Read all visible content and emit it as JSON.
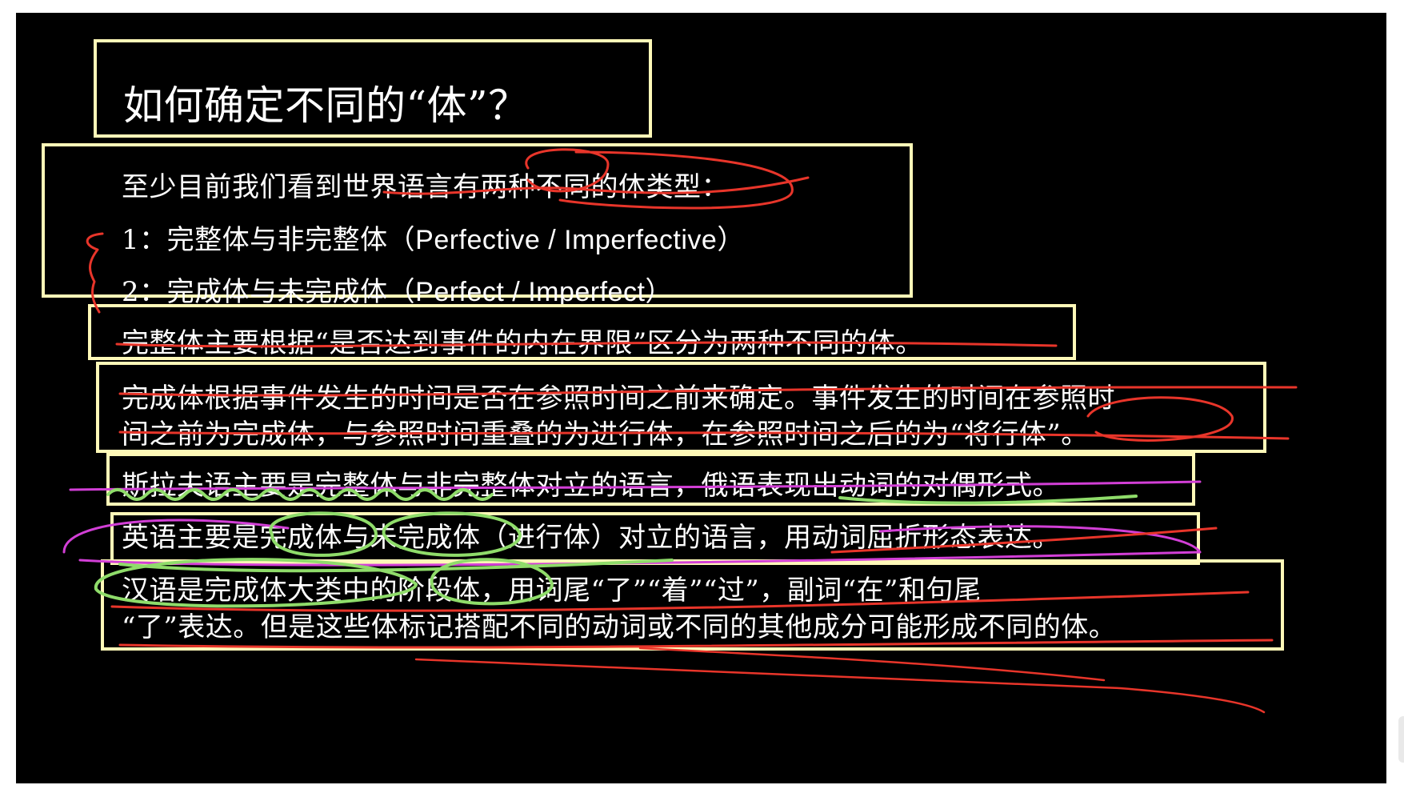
{
  "slide": {
    "title": "如何确定不同的“体”？",
    "intro": {
      "line1": "至少目前我们看到世界语言有两种不同的体类型：",
      "line2_num": "1：完整体与非完整体（",
      "line2_en": "Perfective / Imperfective",
      "line2_end": "）",
      "line3_num": "2：完成体与未完成体（",
      "line3_en": "Perfect / Imperfect",
      "line3_end": "）"
    },
    "perfective_def": "完整体主要根据“是否达到事件的内在界限”区分为两种不同的体。",
    "perfect_def": {
      "line1": "完成体根据事件发生的时间是否在参照时间之前来确定。事件发生的时间在参照时",
      "line2": "间之前为完成体，与参照时间重叠的为进行体，在参照时间之后的为“将行体”。"
    },
    "slavic": "斯拉夫语主要是完整体与非完整体对立的语言，俄语表现出动词的对偶形式。",
    "english": "英语主要是完成体与未完成体（进行体）对立的语言，用动词屈折形态表达。",
    "chinese": {
      "line1": "汉语是完成体大类中的阶段体，用词尾“了”“着”“过”，副词“在”和句尾",
      "line2": "“了”表达。但是这些体标记搭配不同的动词或不同的其他成分可能形成不同的体。"
    }
  },
  "colors": {
    "background": "#000000",
    "box_border": "#fff9b8",
    "text": "#ffffff",
    "ink_red": "#e8352a",
    "ink_magenta": "#d23fd6",
    "ink_green": "#8fdc6a"
  }
}
